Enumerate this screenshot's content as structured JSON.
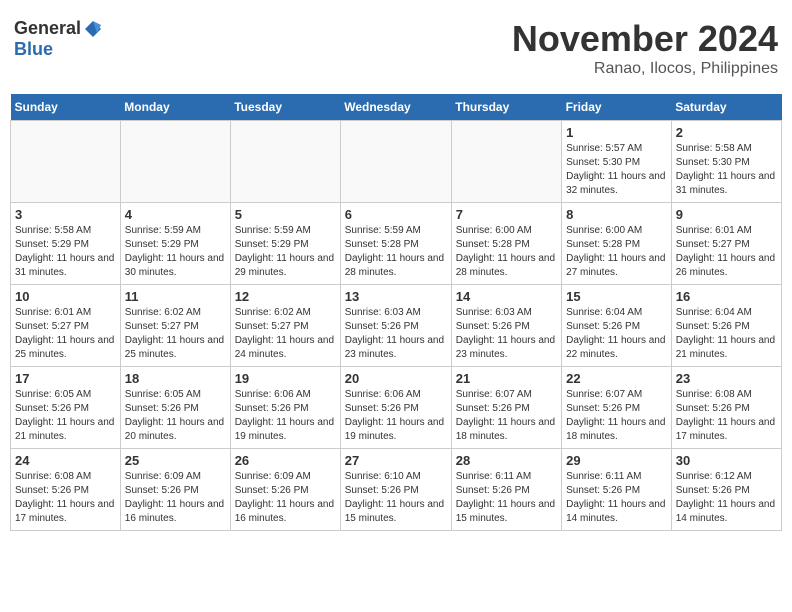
{
  "header": {
    "logo_general": "General",
    "logo_blue": "Blue",
    "month_year": "November 2024",
    "location": "Ranao, Ilocos, Philippines"
  },
  "calendar": {
    "headers": [
      "Sunday",
      "Monday",
      "Tuesday",
      "Wednesday",
      "Thursday",
      "Friday",
      "Saturday"
    ],
    "weeks": [
      [
        {
          "day": "",
          "info": ""
        },
        {
          "day": "",
          "info": ""
        },
        {
          "day": "",
          "info": ""
        },
        {
          "day": "",
          "info": ""
        },
        {
          "day": "",
          "info": ""
        },
        {
          "day": "1",
          "info": "Sunrise: 5:57 AM\nSunset: 5:30 PM\nDaylight: 11 hours and 32 minutes."
        },
        {
          "day": "2",
          "info": "Sunrise: 5:58 AM\nSunset: 5:30 PM\nDaylight: 11 hours and 31 minutes."
        }
      ],
      [
        {
          "day": "3",
          "info": "Sunrise: 5:58 AM\nSunset: 5:29 PM\nDaylight: 11 hours and 31 minutes."
        },
        {
          "day": "4",
          "info": "Sunrise: 5:59 AM\nSunset: 5:29 PM\nDaylight: 11 hours and 30 minutes."
        },
        {
          "day": "5",
          "info": "Sunrise: 5:59 AM\nSunset: 5:29 PM\nDaylight: 11 hours and 29 minutes."
        },
        {
          "day": "6",
          "info": "Sunrise: 5:59 AM\nSunset: 5:28 PM\nDaylight: 11 hours and 28 minutes."
        },
        {
          "day": "7",
          "info": "Sunrise: 6:00 AM\nSunset: 5:28 PM\nDaylight: 11 hours and 28 minutes."
        },
        {
          "day": "8",
          "info": "Sunrise: 6:00 AM\nSunset: 5:28 PM\nDaylight: 11 hours and 27 minutes."
        },
        {
          "day": "9",
          "info": "Sunrise: 6:01 AM\nSunset: 5:27 PM\nDaylight: 11 hours and 26 minutes."
        }
      ],
      [
        {
          "day": "10",
          "info": "Sunrise: 6:01 AM\nSunset: 5:27 PM\nDaylight: 11 hours and 25 minutes."
        },
        {
          "day": "11",
          "info": "Sunrise: 6:02 AM\nSunset: 5:27 PM\nDaylight: 11 hours and 25 minutes."
        },
        {
          "day": "12",
          "info": "Sunrise: 6:02 AM\nSunset: 5:27 PM\nDaylight: 11 hours and 24 minutes."
        },
        {
          "day": "13",
          "info": "Sunrise: 6:03 AM\nSunset: 5:26 PM\nDaylight: 11 hours and 23 minutes."
        },
        {
          "day": "14",
          "info": "Sunrise: 6:03 AM\nSunset: 5:26 PM\nDaylight: 11 hours and 23 minutes."
        },
        {
          "day": "15",
          "info": "Sunrise: 6:04 AM\nSunset: 5:26 PM\nDaylight: 11 hours and 22 minutes."
        },
        {
          "day": "16",
          "info": "Sunrise: 6:04 AM\nSunset: 5:26 PM\nDaylight: 11 hours and 21 minutes."
        }
      ],
      [
        {
          "day": "17",
          "info": "Sunrise: 6:05 AM\nSunset: 5:26 PM\nDaylight: 11 hours and 21 minutes."
        },
        {
          "day": "18",
          "info": "Sunrise: 6:05 AM\nSunset: 5:26 PM\nDaylight: 11 hours and 20 minutes."
        },
        {
          "day": "19",
          "info": "Sunrise: 6:06 AM\nSunset: 5:26 PM\nDaylight: 11 hours and 19 minutes."
        },
        {
          "day": "20",
          "info": "Sunrise: 6:06 AM\nSunset: 5:26 PM\nDaylight: 11 hours and 19 minutes."
        },
        {
          "day": "21",
          "info": "Sunrise: 6:07 AM\nSunset: 5:26 PM\nDaylight: 11 hours and 18 minutes."
        },
        {
          "day": "22",
          "info": "Sunrise: 6:07 AM\nSunset: 5:26 PM\nDaylight: 11 hours and 18 minutes."
        },
        {
          "day": "23",
          "info": "Sunrise: 6:08 AM\nSunset: 5:26 PM\nDaylight: 11 hours and 17 minutes."
        }
      ],
      [
        {
          "day": "24",
          "info": "Sunrise: 6:08 AM\nSunset: 5:26 PM\nDaylight: 11 hours and 17 minutes."
        },
        {
          "day": "25",
          "info": "Sunrise: 6:09 AM\nSunset: 5:26 PM\nDaylight: 11 hours and 16 minutes."
        },
        {
          "day": "26",
          "info": "Sunrise: 6:09 AM\nSunset: 5:26 PM\nDaylight: 11 hours and 16 minutes."
        },
        {
          "day": "27",
          "info": "Sunrise: 6:10 AM\nSunset: 5:26 PM\nDaylight: 11 hours and 15 minutes."
        },
        {
          "day": "28",
          "info": "Sunrise: 6:11 AM\nSunset: 5:26 PM\nDaylight: 11 hours and 15 minutes."
        },
        {
          "day": "29",
          "info": "Sunrise: 6:11 AM\nSunset: 5:26 PM\nDaylight: 11 hours and 14 minutes."
        },
        {
          "day": "30",
          "info": "Sunrise: 6:12 AM\nSunset: 5:26 PM\nDaylight: 11 hours and 14 minutes."
        }
      ]
    ]
  }
}
